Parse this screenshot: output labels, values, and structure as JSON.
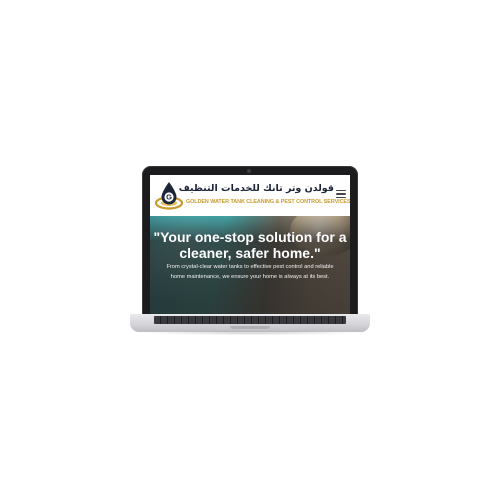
{
  "header": {
    "brand_ar": "قولدن وتر تانك للخدمات التنظيف",
    "brand_en": "GOLDEN WATER TANK CLEANING & PEST CONTROL SERVICES",
    "logo_letter": "G",
    "menu_icon": "hamburger-menu-icon"
  },
  "hero": {
    "title": "\"Your one-stop solution for a cleaner, safer home.\"",
    "text": "From crystal-clear water tanks to effective pest control and reliable home maintenance, we ensure your home is always at its best."
  },
  "colors": {
    "brand_gold": "#c99a2e",
    "brand_navy": "#1c2438",
    "hero_overlay": "#23201e",
    "water_teal": "#2a9aa2"
  }
}
